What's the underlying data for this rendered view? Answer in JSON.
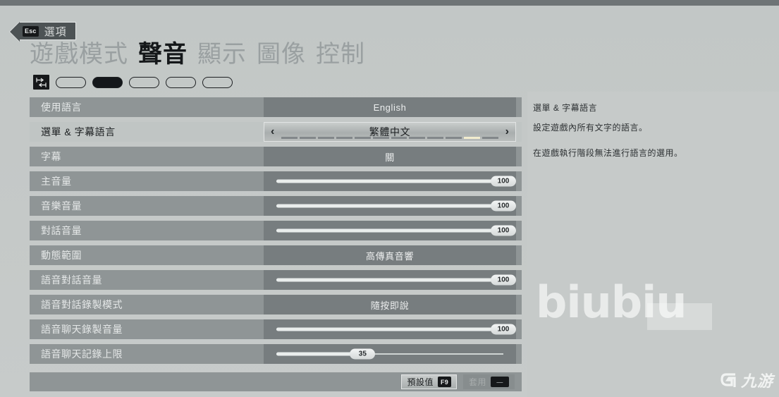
{
  "header": {
    "esc_key": "Esc",
    "esc_label": "選項",
    "back_arrow_icon": "back-arrow-icon"
  },
  "tabs": [
    {
      "label": "遊戲模式",
      "active": false
    },
    {
      "label": "聲音",
      "active": true
    },
    {
      "label": "顯示",
      "active": false
    },
    {
      "label": "圖像",
      "active": false
    },
    {
      "label": "控制",
      "active": false
    }
  ],
  "tab_switch_icon": "tab-switch-icon",
  "settings": {
    "rows": [
      {
        "label": "使用語言",
        "type": "value",
        "value": "English",
        "selected": false
      },
      {
        "label": "選單 & 字幕語言",
        "type": "stepper",
        "value": "繁體中文",
        "selected": true,
        "segments": 12,
        "segment_active": 10,
        "left_arrow": "‹",
        "right_arrow": "›"
      },
      {
        "label": "字幕",
        "type": "value",
        "value": "關",
        "selected": false
      },
      {
        "label": "主音量",
        "type": "slider",
        "value": "100",
        "percent": 100,
        "selected": false
      },
      {
        "label": "音樂音量",
        "type": "slider",
        "value": "100",
        "percent": 100,
        "selected": false
      },
      {
        "label": "對話音量",
        "type": "slider",
        "value": "100",
        "percent": 100,
        "selected": false
      },
      {
        "label": "動態範圍",
        "type": "value",
        "value": "高傳真音響",
        "selected": false
      },
      {
        "label": "語音對話音量",
        "type": "slider",
        "value": "100",
        "percent": 100,
        "selected": false
      },
      {
        "label": "語音對話錄製模式",
        "type": "value",
        "value": "隨按即說",
        "selected": false
      },
      {
        "label": "語音聊天錄製音量",
        "type": "slider",
        "value": "100",
        "percent": 100,
        "selected": false
      },
      {
        "label": "語音聊天記錄上限",
        "type": "slider",
        "value": "35",
        "percent": 38,
        "selected": false
      }
    ]
  },
  "footer": {
    "defaults_label": "預設值",
    "defaults_key": "F9",
    "apply_label": "套用",
    "apply_key": "—",
    "apply_disabled": true
  },
  "description": {
    "title": "選單 & 字幕語言",
    "line1": "設定遊戲內所有文字的語言。",
    "line2": "在遊戲執行階段無法進行語言的選用。"
  },
  "watermark": {
    "text": "biubiu",
    "logo_text": "九游",
    "logo_mark_icon": "g-mark-icon"
  },
  "colors": {
    "page_bg": "#c4c8c7",
    "row_bg": "#8f9596",
    "row_selected_bg": "#c0c5c4",
    "value_bg": "#777d7f",
    "segment_active": "#f2ecce",
    "panel_bg": "#c6cac9",
    "tab_active": "#15181a",
    "tab_inactive": "#9aa0a1"
  }
}
